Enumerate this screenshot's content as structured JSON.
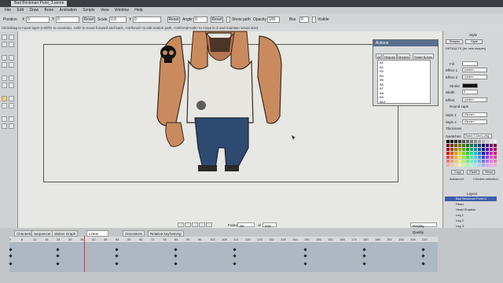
{
  "document_tab": "Bad Brickman Point_3.anme",
  "menus": [
    "File",
    "Edit",
    "Draw",
    "Bone",
    "Animation",
    "Scripts",
    "View",
    "Window",
    "Help"
  ],
  "toolbar": {
    "position_label": "Position",
    "x_label": "X",
    "x_value": "0",
    "y_label": "Y",
    "y_value": "0",
    "reset_label": "Reset",
    "scale_label": "Scale",
    "scale_x": "0.0",
    "scale_y_label": "Y",
    "scale_y": "0",
    "reset2_label": "Reset",
    "angle_label": "Angle",
    "angle_value": "0",
    "show_path_label": "Show path",
    "opacity_label": "Opacity",
    "opacity_value": "100",
    "blur_label": "Blur",
    "blur_value": "0",
    "visible_label": "Visible"
  },
  "hint_text": "Click/drag to move layer (<shift> to constrain, <alt> to move forward and back, <ctrl/cmd> to edit motion path, <ctrl/cmd><alt> to move in Z and maintain visual size)",
  "actions_panel": {
    "title": "Actions",
    "tabs": [
      "All",
      "Regular",
      "Morphs",
      "Smart Bones"
    ],
    "items": [
      "B1",
      "B2",
      "B3",
      "B4",
      "B5",
      "B6",
      "B7",
      "B8",
      "B9",
      "B10",
      "B11",
      "B12",
      "B13",
      "B14",
      "B15",
      "B16",
      "B17"
    ],
    "selected_index": 16
  },
  "style_panel": {
    "title": "Style",
    "shapes_btn": "Shapes",
    "style_btn": "Style",
    "defaults_label": "DEFAULTS (for new shapes)",
    "fill_label": "Fill",
    "effect1_label": "Effect 1",
    "effect1_value": "<plain>",
    "effect2_label": "Effect 2",
    "effect2_value": "<plain>",
    "stroke_label": "Stroke",
    "width_label": "Width",
    "width_value": "0",
    "effect_label": "Effect",
    "effect_value": "<plain>",
    "round_caps_label": "Round caps",
    "style1_label": "Style 1",
    "style1_value": "<None>",
    "style2_label": "Style 2",
    "style2_value": "<None>",
    "thickness_label": "Thickness",
    "swatches_label": "Swatches",
    "swatches_value": "Basic Colors.png",
    "copy_btn": "Copy",
    "paste_btn": "Paste",
    "reset_btn": "Reset",
    "advanced_label": "Advanced",
    "checker_label": "Checker selection"
  },
  "layers_panel": {
    "title": "Layers",
    "rows": [
      "Bad Brickman Point N",
      "Head",
      "Head Shadow",
      "Leg 1",
      "Leg 2",
      "Leg 3",
      "Leg 4",
      "Leg 5",
      "Leg 6",
      "Foot 1",
      "Foot 2",
      "Leg 1",
      "Pocket",
      "Leg Shadow",
      "Leg 2"
    ]
  },
  "timeline": {
    "tabs": [
      "Channels",
      "Sequencer",
      "Motion Graph"
    ],
    "interp_value": "Linear",
    "onionskins_label": "Onionskins",
    "relative_label": "Relative keyframing",
    "frame_label": "Frame",
    "frame_value": "38",
    "of_label": "of",
    "total_value": "240",
    "quality_value": "Display Quality",
    "ticks": [
      "0",
      "6",
      "12",
      "18",
      "24",
      "30",
      "36",
      "42",
      "48",
      "54",
      "60",
      "66",
      "72",
      "78",
      "84",
      "90",
      "96",
      "102",
      "108",
      "114",
      "120",
      "126",
      "132",
      "138",
      "144",
      "150",
      "156",
      "162",
      "168",
      "174",
      "180",
      "186",
      "192",
      "198",
      "204",
      "210"
    ]
  },
  "colors": {
    "selection": "#3b5ea8",
    "canvas": "#e7e7e3",
    "playhead": "#d83030",
    "skin": "#c98a5e",
    "jeans": "#2f4a70"
  }
}
